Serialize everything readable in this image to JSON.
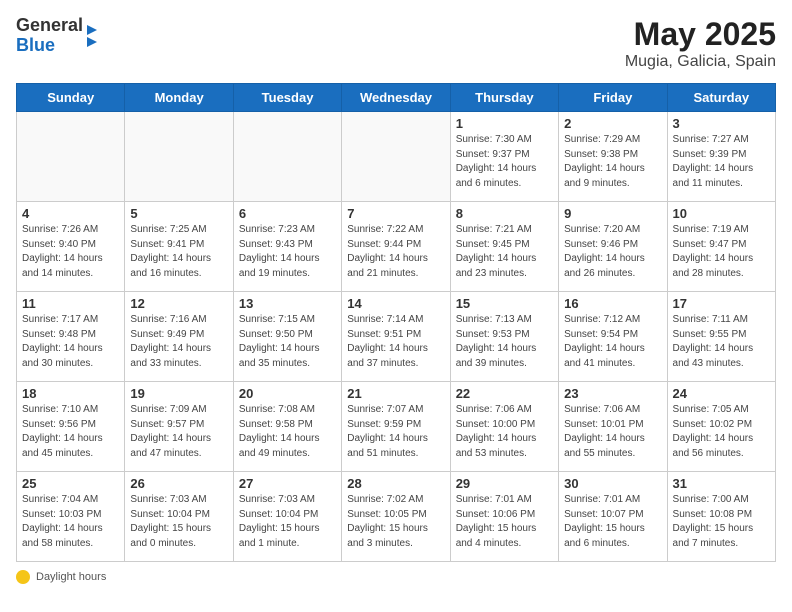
{
  "header": {
    "logo_general": "General",
    "logo_blue": "Blue",
    "title": "May 2025",
    "subtitle": "Mugia, Galicia, Spain"
  },
  "weekdays": [
    "Sunday",
    "Monday",
    "Tuesday",
    "Wednesday",
    "Thursday",
    "Friday",
    "Saturday"
  ],
  "weeks": [
    [
      {
        "day": "",
        "info": ""
      },
      {
        "day": "",
        "info": ""
      },
      {
        "day": "",
        "info": ""
      },
      {
        "day": "",
        "info": ""
      },
      {
        "day": "1",
        "info": "Sunrise: 7:30 AM\nSunset: 9:37 PM\nDaylight: 14 hours\nand 6 minutes."
      },
      {
        "day": "2",
        "info": "Sunrise: 7:29 AM\nSunset: 9:38 PM\nDaylight: 14 hours\nand 9 minutes."
      },
      {
        "day": "3",
        "info": "Sunrise: 7:27 AM\nSunset: 9:39 PM\nDaylight: 14 hours\nand 11 minutes."
      }
    ],
    [
      {
        "day": "4",
        "info": "Sunrise: 7:26 AM\nSunset: 9:40 PM\nDaylight: 14 hours\nand 14 minutes."
      },
      {
        "day": "5",
        "info": "Sunrise: 7:25 AM\nSunset: 9:41 PM\nDaylight: 14 hours\nand 16 minutes."
      },
      {
        "day": "6",
        "info": "Sunrise: 7:23 AM\nSunset: 9:43 PM\nDaylight: 14 hours\nand 19 minutes."
      },
      {
        "day": "7",
        "info": "Sunrise: 7:22 AM\nSunset: 9:44 PM\nDaylight: 14 hours\nand 21 minutes."
      },
      {
        "day": "8",
        "info": "Sunrise: 7:21 AM\nSunset: 9:45 PM\nDaylight: 14 hours\nand 23 minutes."
      },
      {
        "day": "9",
        "info": "Sunrise: 7:20 AM\nSunset: 9:46 PM\nDaylight: 14 hours\nand 26 minutes."
      },
      {
        "day": "10",
        "info": "Sunrise: 7:19 AM\nSunset: 9:47 PM\nDaylight: 14 hours\nand 28 minutes."
      }
    ],
    [
      {
        "day": "11",
        "info": "Sunrise: 7:17 AM\nSunset: 9:48 PM\nDaylight: 14 hours\nand 30 minutes."
      },
      {
        "day": "12",
        "info": "Sunrise: 7:16 AM\nSunset: 9:49 PM\nDaylight: 14 hours\nand 33 minutes."
      },
      {
        "day": "13",
        "info": "Sunrise: 7:15 AM\nSunset: 9:50 PM\nDaylight: 14 hours\nand 35 minutes."
      },
      {
        "day": "14",
        "info": "Sunrise: 7:14 AM\nSunset: 9:51 PM\nDaylight: 14 hours\nand 37 minutes."
      },
      {
        "day": "15",
        "info": "Sunrise: 7:13 AM\nSunset: 9:53 PM\nDaylight: 14 hours\nand 39 minutes."
      },
      {
        "day": "16",
        "info": "Sunrise: 7:12 AM\nSunset: 9:54 PM\nDaylight: 14 hours\nand 41 minutes."
      },
      {
        "day": "17",
        "info": "Sunrise: 7:11 AM\nSunset: 9:55 PM\nDaylight: 14 hours\nand 43 minutes."
      }
    ],
    [
      {
        "day": "18",
        "info": "Sunrise: 7:10 AM\nSunset: 9:56 PM\nDaylight: 14 hours\nand 45 minutes."
      },
      {
        "day": "19",
        "info": "Sunrise: 7:09 AM\nSunset: 9:57 PM\nDaylight: 14 hours\nand 47 minutes."
      },
      {
        "day": "20",
        "info": "Sunrise: 7:08 AM\nSunset: 9:58 PM\nDaylight: 14 hours\nand 49 minutes."
      },
      {
        "day": "21",
        "info": "Sunrise: 7:07 AM\nSunset: 9:59 PM\nDaylight: 14 hours\nand 51 minutes."
      },
      {
        "day": "22",
        "info": "Sunrise: 7:06 AM\nSunset: 10:00 PM\nDaylight: 14 hours\nand 53 minutes."
      },
      {
        "day": "23",
        "info": "Sunrise: 7:06 AM\nSunset: 10:01 PM\nDaylight: 14 hours\nand 55 minutes."
      },
      {
        "day": "24",
        "info": "Sunrise: 7:05 AM\nSunset: 10:02 PM\nDaylight: 14 hours\nand 56 minutes."
      }
    ],
    [
      {
        "day": "25",
        "info": "Sunrise: 7:04 AM\nSunset: 10:03 PM\nDaylight: 14 hours\nand 58 minutes."
      },
      {
        "day": "26",
        "info": "Sunrise: 7:03 AM\nSunset: 10:04 PM\nDaylight: 15 hours\nand 0 minutes."
      },
      {
        "day": "27",
        "info": "Sunrise: 7:03 AM\nSunset: 10:04 PM\nDaylight: 15 hours\nand 1 minute."
      },
      {
        "day": "28",
        "info": "Sunrise: 7:02 AM\nSunset: 10:05 PM\nDaylight: 15 hours\nand 3 minutes."
      },
      {
        "day": "29",
        "info": "Sunrise: 7:01 AM\nSunset: 10:06 PM\nDaylight: 15 hours\nand 4 minutes."
      },
      {
        "day": "30",
        "info": "Sunrise: 7:01 AM\nSunset: 10:07 PM\nDaylight: 15 hours\nand 6 minutes."
      },
      {
        "day": "31",
        "info": "Sunrise: 7:00 AM\nSunset: 10:08 PM\nDaylight: 15 hours\nand 7 minutes."
      }
    ]
  ],
  "footer": {
    "label": "Daylight hours"
  }
}
